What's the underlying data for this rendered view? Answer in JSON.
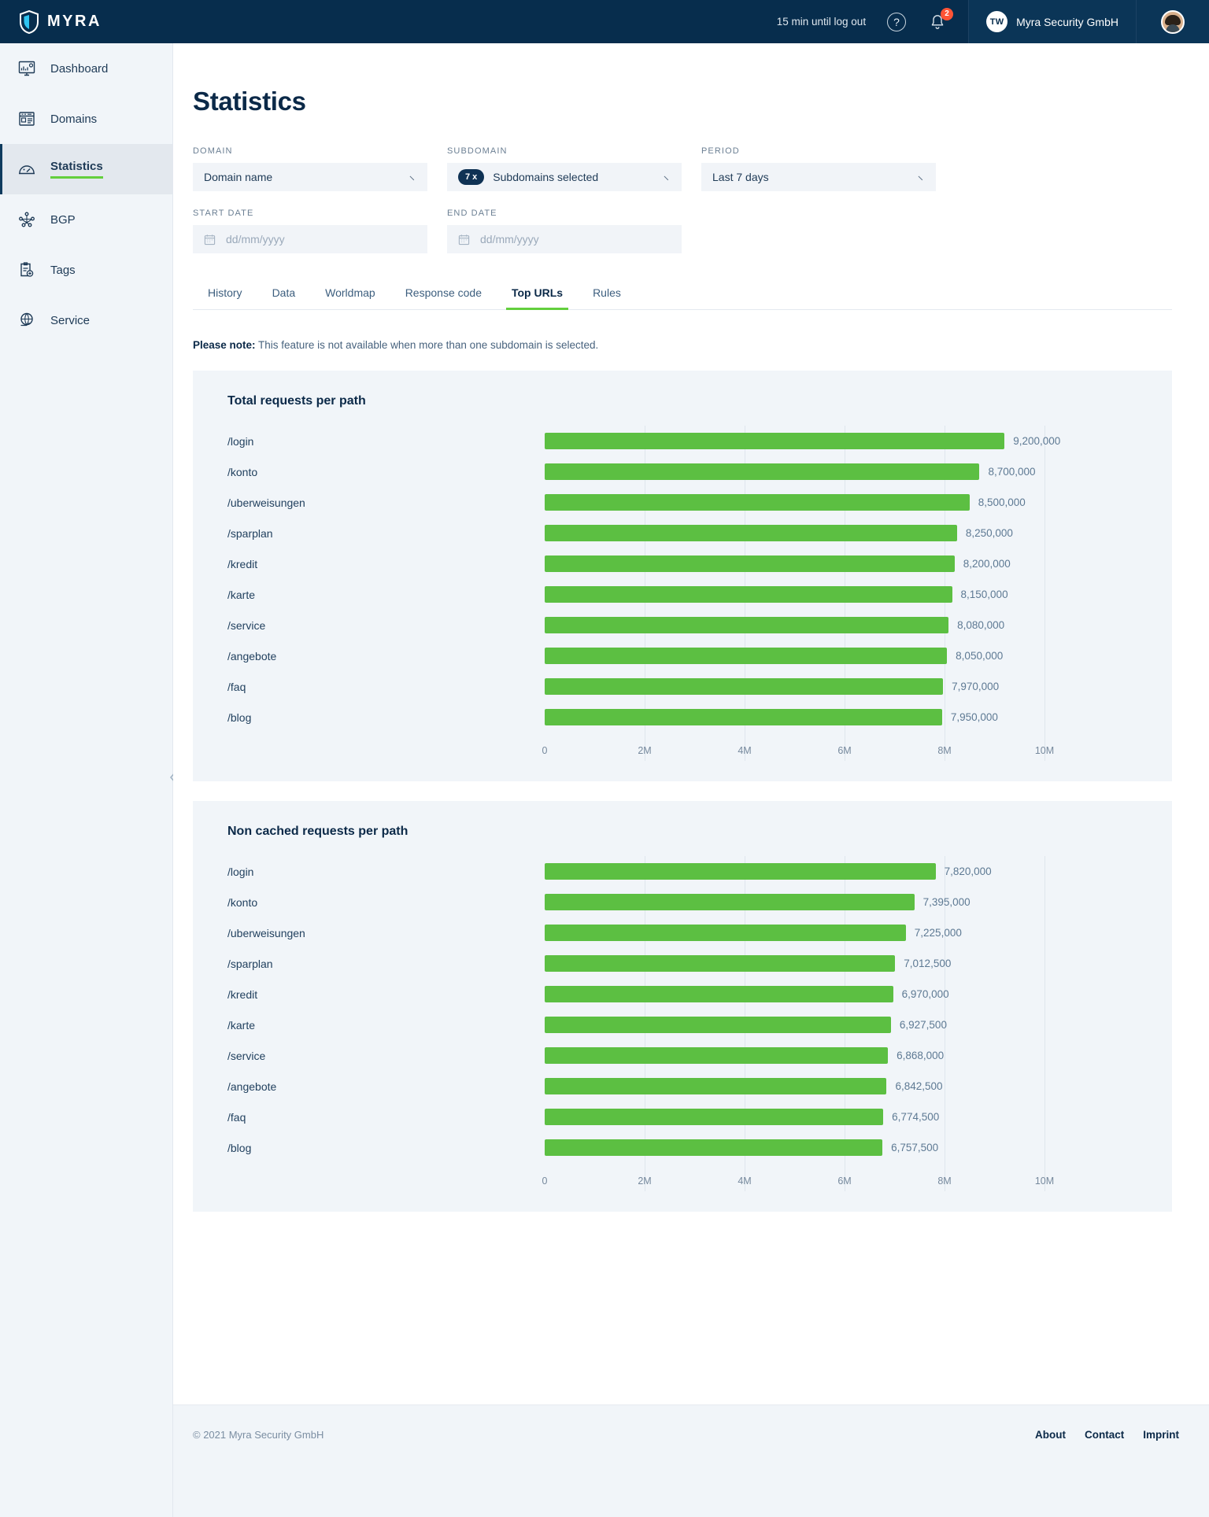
{
  "topbar": {
    "brand": "MYRA",
    "logout_text": "15 min until log out",
    "help_glyph": "?",
    "notification_count": "2",
    "org_initials": "TW",
    "org_name": "Myra Security GmbH"
  },
  "sidebar": {
    "items": [
      {
        "label": "Dashboard",
        "icon": "dashboard-icon",
        "active": false
      },
      {
        "label": "Domains",
        "icon": "domains-icon",
        "active": false
      },
      {
        "label": "Statistics",
        "icon": "statistics-icon",
        "active": true
      },
      {
        "label": "BGP",
        "icon": "bgp-icon",
        "active": false
      },
      {
        "label": "Tags",
        "icon": "tags-icon",
        "active": false
      },
      {
        "label": "Service",
        "icon": "service-icon",
        "active": false
      }
    ]
  },
  "page": {
    "title": "Statistics"
  },
  "filters": {
    "domain_label": "DOMAIN",
    "domain_value": "Domain name",
    "subdomain_label": "SUBDOMAIN",
    "subdomain_badge": "7 x",
    "subdomain_value": "Subdomains selected",
    "period_label": "PERIOD",
    "period_value": "Last 7 days",
    "start_date_label": "START DATE",
    "start_date_placeholder": "dd/mm/yyyy",
    "start_date_value": "",
    "end_date_label": "END DATE",
    "end_date_placeholder": "dd/mm/yyyy",
    "end_date_value": ""
  },
  "tabs": [
    {
      "label": "History",
      "active": false
    },
    {
      "label": "Data",
      "active": false
    },
    {
      "label": "Worldmap",
      "active": false
    },
    {
      "label": "Response code",
      "active": false
    },
    {
      "label": "Top URLs",
      "active": true
    },
    {
      "label": "Rules",
      "active": false
    }
  ],
  "note": {
    "bold": "Please note:",
    "text": " This feature is not available when more than one subdomain is selected."
  },
  "colors": {
    "bar_green": "#5cbf42",
    "accent_green": "#63cf3d",
    "brand_navy": "#072d4d",
    "badge_red": "#ff5436"
  },
  "footer": {
    "copyright": "© 2021 Myra Security GmbH",
    "links": [
      "About",
      "Contact",
      "Imprint"
    ]
  },
  "chart_data": [
    {
      "type": "bar",
      "orientation": "horizontal",
      "title": "Total requests per path",
      "xlabel": "",
      "ylabel": "",
      "xlim": [
        0,
        10000000
      ],
      "grid": true,
      "legend": "none",
      "tick_labels": [
        "0",
        "2M",
        "4M",
        "6M",
        "8M",
        "10M"
      ],
      "tick_values": [
        0,
        2000000,
        4000000,
        6000000,
        8000000,
        10000000
      ],
      "categories": [
        "/login",
        "/konto",
        "/uberweisungen",
        "/sparplan",
        "/kredit",
        "/karte",
        "/service",
        "/angebote",
        "/faq",
        "/blog"
      ],
      "values": [
        9200000,
        8700000,
        8500000,
        8250000,
        8200000,
        8150000,
        8080000,
        8050000,
        7970000,
        7950000
      ],
      "value_labels": [
        "9,200,000",
        "8,700,000",
        "8,500,000",
        "8,250,000",
        "8,200,000",
        "8,150,000",
        "8,080,000",
        "8,050,000",
        "7,970,000",
        "7,950,000"
      ]
    },
    {
      "type": "bar",
      "orientation": "horizontal",
      "title": "Non cached requests per path",
      "xlabel": "",
      "ylabel": "",
      "xlim": [
        0,
        10000000
      ],
      "grid": true,
      "legend": "none",
      "tick_labels": [
        "0",
        "2M",
        "4M",
        "6M",
        "8M",
        "10M"
      ],
      "tick_values": [
        0,
        2000000,
        4000000,
        6000000,
        8000000,
        10000000
      ],
      "categories": [
        "/login",
        "/konto",
        "/uberweisungen",
        "/sparplan",
        "/kredit",
        "/karte",
        "/service",
        "/angebote",
        "/faq",
        "/blog"
      ],
      "values": [
        7820000,
        7395000,
        7225000,
        7012500,
        6970000,
        6927500,
        6868000,
        6842500,
        6774500,
        6757500
      ],
      "value_labels": [
        "7,820,000",
        "7,395,000",
        "7,225,000",
        "7,012,500",
        "6,970,000",
        "6,927,500",
        "6,868,000",
        "6,842,500",
        "6,774,500",
        "6,757,500"
      ]
    }
  ]
}
